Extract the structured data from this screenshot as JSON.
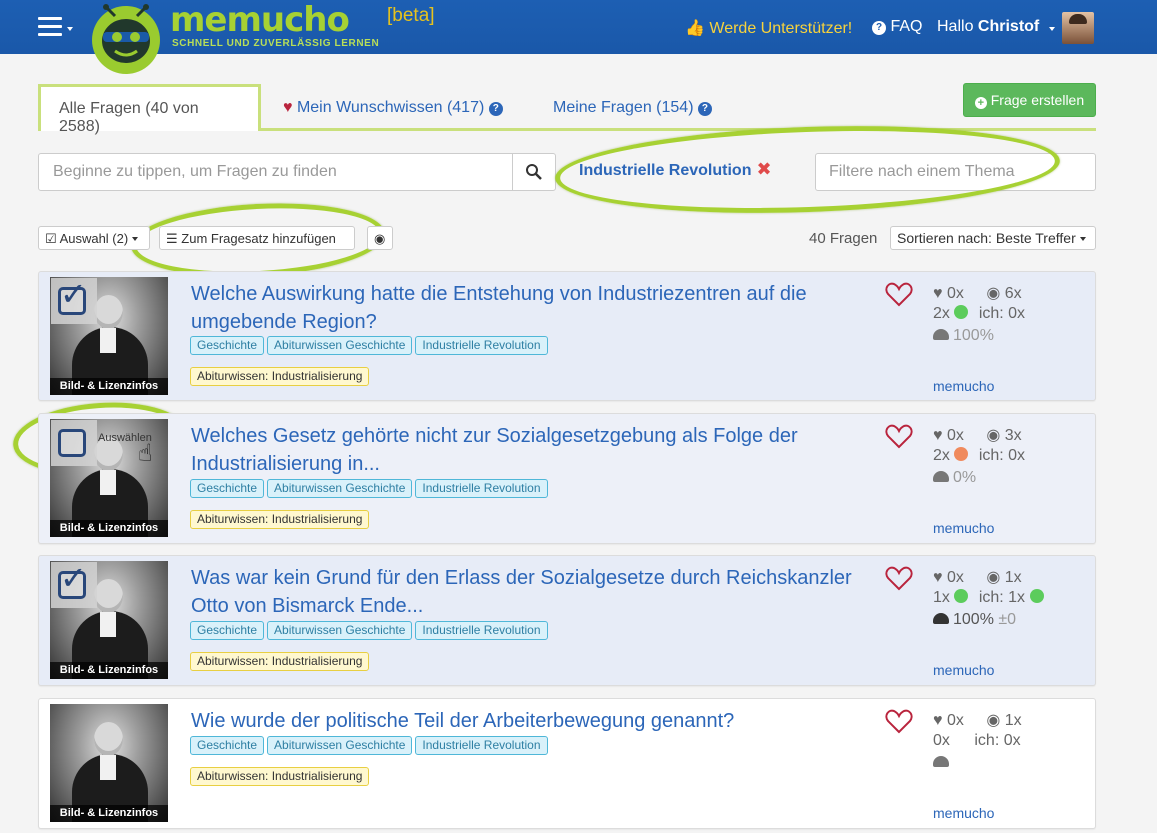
{
  "header": {
    "logo_text": "memucho",
    "beta": "[beta]",
    "slogan": "SCHNELL UND ZUVERLÄSSIG LERNEN",
    "supporter": "Werde Unterstützer!",
    "faq": "FAQ",
    "hallo": "Hallo",
    "user": "Christof",
    "primary_color": "#1d5fb3",
    "accent_color": "#a7d133"
  },
  "tabs": [
    {
      "label": "Alle Fragen (40 von 2588)",
      "active": true
    },
    {
      "label": "Mein Wunschwissen (417)",
      "icon": "heart-icon"
    },
    {
      "label": "Meine Fragen (154)"
    }
  ],
  "create_button": "Frage erstellen",
  "search": {
    "placeholder": "Beginne zu tippen, um Fragen zu finden",
    "topic_filter_placeholder": "Filtere nach einem Thema",
    "selected_topic": "Industrielle Revolution"
  },
  "toolbar": {
    "selection_label": "Auswahl (2)",
    "add_to_set_label": "Zum Fragesatz hinzufügen",
    "question_count": "40 Fragen",
    "sort_label": "Sortieren nach: Beste Treffer"
  },
  "questions": [
    {
      "title": "Welche Auswirkung hatte die Entstehung von Industriezentren auf die umgebende Region?",
      "image_label": "Bild- & Lizenzinfos",
      "selected": true,
      "tags": [
        "Geschichte",
        "Abiturwissen Geschichte",
        "Industrielle Revolution"
      ],
      "topic": "Abiturwissen: Industrialisierung",
      "favorites": "0x",
      "views": "6x",
      "answers": "2x",
      "answer_status_color": "#5ccc5c",
      "mine": "ich: 0x",
      "correctness": "100%",
      "author": "memucho"
    },
    {
      "title": "Welches Gesetz gehörte nicht zur Sozialgesetzgebung als Folge der Industrialisierung in...",
      "image_label": "Bild- & Lizenzinfos",
      "selected": false,
      "hover_label": "Auswählen",
      "tags": [
        "Geschichte",
        "Abiturwissen Geschichte",
        "Industrielle Revolution"
      ],
      "topic": "Abiturwissen: Industrialisierung",
      "favorites": "0x",
      "views": "3x",
      "answers": "2x",
      "answer_status_color": "#f08a5d",
      "mine": "ich: 0x",
      "correctness": "0%",
      "author": "memucho"
    },
    {
      "title": "Was war kein Grund für den Erlass der Sozialgesetze durch Reichskanzler Otto von Bismarck Ende...",
      "image_label": "Bild- & Lizenzinfos",
      "selected": true,
      "tags": [
        "Geschichte",
        "Abiturwissen Geschichte",
        "Industrielle Revolution"
      ],
      "topic": "Abiturwissen: Industrialisierung",
      "favorites": "0x",
      "views": "1x",
      "answers": "1x",
      "answer_status_color": "#5ccc5c",
      "mine": "ich: 1x",
      "mine_status_color": "#5ccc5c",
      "correctness": "100%",
      "delta": "±0",
      "author": "memucho"
    },
    {
      "title": "Wie wurde der politische Teil der Arbeiterbewegung genannt?",
      "image_label": "Bild- & Lizenzinfos",
      "selected": false,
      "tags": [
        "Geschichte",
        "Abiturwissen Geschichte",
        "Industrielle Revolution"
      ],
      "topic": "Abiturwissen: Industrialisierung",
      "favorites": "0x",
      "views": "1x",
      "answers": "0x",
      "mine": "ich: 0x",
      "author": "memucho"
    }
  ]
}
